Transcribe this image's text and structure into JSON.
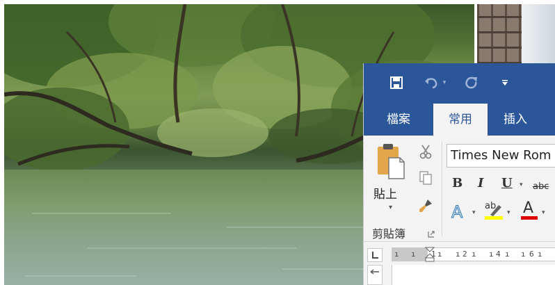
{
  "word": {
    "quick_access": {
      "save_icon": "floppy-disk-icon",
      "undo_icon": "undo-arrow-icon",
      "redo_icon": "redo-arrow-icon",
      "customize_icon": "dropdown-caret-icon"
    },
    "tabs": [
      {
        "label": "檔案",
        "active": false
      },
      {
        "label": "常用",
        "active": true
      },
      {
        "label": "插入",
        "active": false
      }
    ],
    "clipboard": {
      "paste_label": "貼上",
      "group_label": "剪貼簿",
      "paste_icon": "clipboard-paste-icon",
      "cut_icon": "scissors-icon",
      "copy_icon": "copy-pages-icon",
      "format_painter_icon": "paintbrush-icon"
    },
    "font": {
      "font_name": "Times New Rom",
      "bold": "B",
      "italic": "I",
      "underline": "U",
      "strikethrough": "abc",
      "text_effects": "A",
      "highlight": "ab",
      "font_color": "A",
      "highlight_color": "#ffff00",
      "font_color_bar": "#e00000"
    },
    "ruler": {
      "marks": [
        "1",
        "2",
        "4",
        "6"
      ],
      "corner_icon": "tab-stop-icon",
      "indent_icon": "hanging-indent-icon"
    },
    "colors": {
      "title_bar": "#2b579a",
      "ribbon": "#f3f3f3"
    }
  }
}
